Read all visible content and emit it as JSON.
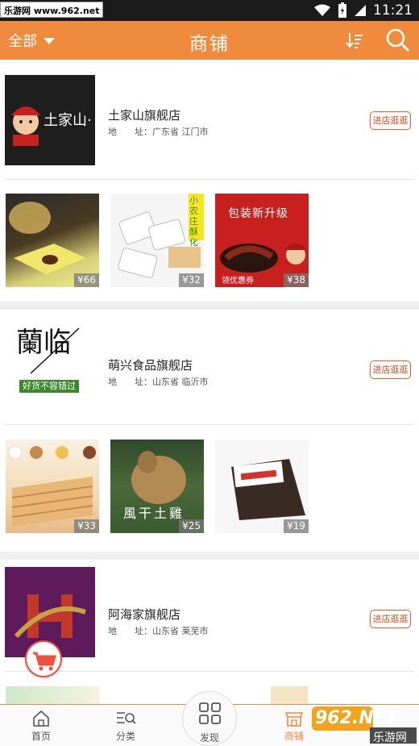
{
  "status_bar": {
    "watermark": "乐游网 www.962.net",
    "time": "11:21"
  },
  "header": {
    "filter_label": "全部",
    "title": "商铺"
  },
  "addr_label": "地　　址：",
  "enter_label": "进店逛逛",
  "shops": [
    {
      "name": "土家山旗舰店",
      "address": "广东省 江门市",
      "logo_text": "土家山·",
      "products": [
        {
          "price": "¥66"
        },
        {
          "price": "¥32"
        },
        {
          "price": "¥38"
        }
      ]
    },
    {
      "name": "萌兴食品旗舰店",
      "address": "山东省 临沂市",
      "logo_text": "蘭临",
      "logo_slogan": "好货不容错过",
      "products": [
        {
          "price": "¥33"
        },
        {
          "price": "¥25"
        },
        {
          "price": "¥19"
        }
      ]
    },
    {
      "name": "阿海家旗舰店",
      "address": "山东省 莱芜市",
      "products": []
    }
  ],
  "product_captions": {
    "p2_side": "小农庄酥化",
    "p3_top": "包装新升级",
    "p3_bottom": "领优惠券",
    "p5_text": "風干土雞"
  },
  "bottom_nav": [
    {
      "label": "首页"
    },
    {
      "label": "分类"
    },
    {
      "label": "发现"
    },
    {
      "label": "商铺"
    }
  ],
  "watermark_bottom": "962.NET",
  "watermark_bottom_sub": "乐游网",
  "colors": {
    "accent": "#f08a3c",
    "button_red": "#f05a28"
  }
}
